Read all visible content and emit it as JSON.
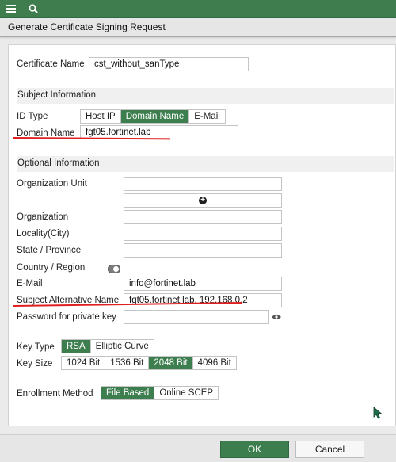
{
  "colors": {
    "accent": "#3d7e4f",
    "annotation_underline": "#e02020"
  },
  "topbar": {
    "icons": [
      "menu-icon",
      "search-icon"
    ]
  },
  "header": {
    "title": "Generate Certificate Signing Request"
  },
  "form": {
    "certificate_name": {
      "label": "Certificate Name",
      "value": "cst_without_sanType"
    },
    "subject_information": {
      "title": "Subject Information",
      "id_type": {
        "label": "ID Type",
        "options": [
          "Host IP",
          "Domain Name",
          "E-Mail"
        ],
        "selected": "Domain Name"
      },
      "domain_name": {
        "label": "Domain Name",
        "value": "fgt05.fortinet.lab"
      }
    },
    "optional_information": {
      "title": "Optional Information",
      "organization_unit": {
        "label": "Organization Unit",
        "value": ""
      },
      "organization": {
        "label": "Organization",
        "value": ""
      },
      "locality": {
        "label": "Locality(City)",
        "value": ""
      },
      "state": {
        "label": "State / Province",
        "value": ""
      },
      "country": {
        "label": "Country / Region",
        "toggle": "off"
      },
      "email": {
        "label": "E-Mail",
        "value": "info@fortinet.lab"
      },
      "san": {
        "label": "Subject Alternative Name",
        "value": "fgt05.fortinet.lab, 192.168.0.2"
      },
      "password": {
        "label": "Password for private key",
        "value": ""
      }
    },
    "key_type": {
      "label": "Key Type",
      "options": [
        "RSA",
        "Elliptic Curve"
      ],
      "selected": "RSA"
    },
    "key_size": {
      "label": "Key Size",
      "options": [
        "1024 Bit",
        "1536 Bit",
        "2048 Bit",
        "4096 Bit"
      ],
      "selected": "2048 Bit"
    },
    "enrollment": {
      "label": "Enrollment Method",
      "options": [
        "File Based",
        "Online SCEP"
      ],
      "selected": "File Based"
    }
  },
  "footer": {
    "ok_label": "OK",
    "cancel_label": "Cancel"
  }
}
